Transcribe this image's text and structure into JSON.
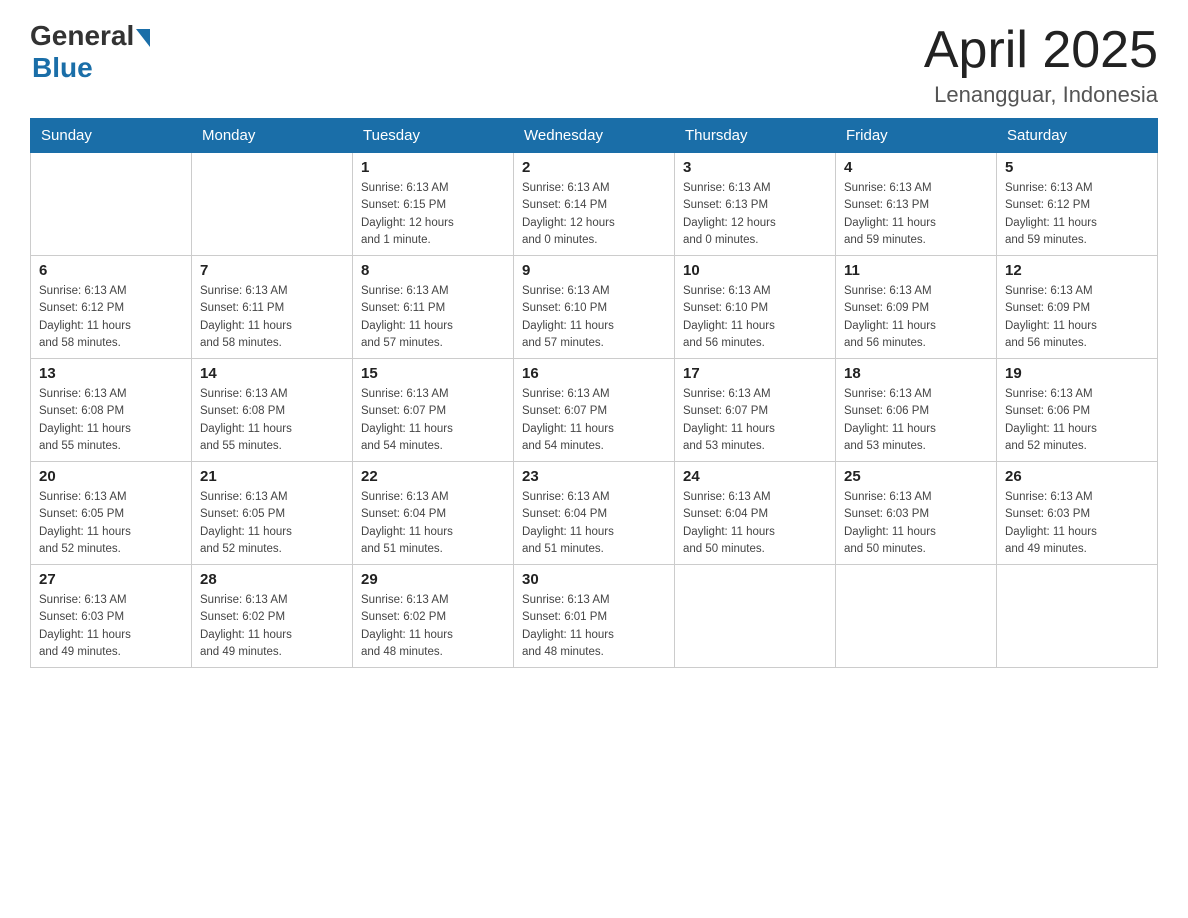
{
  "header": {
    "logo_general": "General",
    "logo_blue": "Blue",
    "month_title": "April 2025",
    "location": "Lenangguar, Indonesia"
  },
  "calendar": {
    "days_of_week": [
      "Sunday",
      "Monday",
      "Tuesday",
      "Wednesday",
      "Thursday",
      "Friday",
      "Saturday"
    ],
    "weeks": [
      [
        {
          "day": "",
          "info": ""
        },
        {
          "day": "",
          "info": ""
        },
        {
          "day": "1",
          "info": "Sunrise: 6:13 AM\nSunset: 6:15 PM\nDaylight: 12 hours\nand 1 minute."
        },
        {
          "day": "2",
          "info": "Sunrise: 6:13 AM\nSunset: 6:14 PM\nDaylight: 12 hours\nand 0 minutes."
        },
        {
          "day": "3",
          "info": "Sunrise: 6:13 AM\nSunset: 6:13 PM\nDaylight: 12 hours\nand 0 minutes."
        },
        {
          "day": "4",
          "info": "Sunrise: 6:13 AM\nSunset: 6:13 PM\nDaylight: 11 hours\nand 59 minutes."
        },
        {
          "day": "5",
          "info": "Sunrise: 6:13 AM\nSunset: 6:12 PM\nDaylight: 11 hours\nand 59 minutes."
        }
      ],
      [
        {
          "day": "6",
          "info": "Sunrise: 6:13 AM\nSunset: 6:12 PM\nDaylight: 11 hours\nand 58 minutes."
        },
        {
          "day": "7",
          "info": "Sunrise: 6:13 AM\nSunset: 6:11 PM\nDaylight: 11 hours\nand 58 minutes."
        },
        {
          "day": "8",
          "info": "Sunrise: 6:13 AM\nSunset: 6:11 PM\nDaylight: 11 hours\nand 57 minutes."
        },
        {
          "day": "9",
          "info": "Sunrise: 6:13 AM\nSunset: 6:10 PM\nDaylight: 11 hours\nand 57 minutes."
        },
        {
          "day": "10",
          "info": "Sunrise: 6:13 AM\nSunset: 6:10 PM\nDaylight: 11 hours\nand 56 minutes."
        },
        {
          "day": "11",
          "info": "Sunrise: 6:13 AM\nSunset: 6:09 PM\nDaylight: 11 hours\nand 56 minutes."
        },
        {
          "day": "12",
          "info": "Sunrise: 6:13 AM\nSunset: 6:09 PM\nDaylight: 11 hours\nand 56 minutes."
        }
      ],
      [
        {
          "day": "13",
          "info": "Sunrise: 6:13 AM\nSunset: 6:08 PM\nDaylight: 11 hours\nand 55 minutes."
        },
        {
          "day": "14",
          "info": "Sunrise: 6:13 AM\nSunset: 6:08 PM\nDaylight: 11 hours\nand 55 minutes."
        },
        {
          "day": "15",
          "info": "Sunrise: 6:13 AM\nSunset: 6:07 PM\nDaylight: 11 hours\nand 54 minutes."
        },
        {
          "day": "16",
          "info": "Sunrise: 6:13 AM\nSunset: 6:07 PM\nDaylight: 11 hours\nand 54 minutes."
        },
        {
          "day": "17",
          "info": "Sunrise: 6:13 AM\nSunset: 6:07 PM\nDaylight: 11 hours\nand 53 minutes."
        },
        {
          "day": "18",
          "info": "Sunrise: 6:13 AM\nSunset: 6:06 PM\nDaylight: 11 hours\nand 53 minutes."
        },
        {
          "day": "19",
          "info": "Sunrise: 6:13 AM\nSunset: 6:06 PM\nDaylight: 11 hours\nand 52 minutes."
        }
      ],
      [
        {
          "day": "20",
          "info": "Sunrise: 6:13 AM\nSunset: 6:05 PM\nDaylight: 11 hours\nand 52 minutes."
        },
        {
          "day": "21",
          "info": "Sunrise: 6:13 AM\nSunset: 6:05 PM\nDaylight: 11 hours\nand 52 minutes."
        },
        {
          "day": "22",
          "info": "Sunrise: 6:13 AM\nSunset: 6:04 PM\nDaylight: 11 hours\nand 51 minutes."
        },
        {
          "day": "23",
          "info": "Sunrise: 6:13 AM\nSunset: 6:04 PM\nDaylight: 11 hours\nand 51 minutes."
        },
        {
          "day": "24",
          "info": "Sunrise: 6:13 AM\nSunset: 6:04 PM\nDaylight: 11 hours\nand 50 minutes."
        },
        {
          "day": "25",
          "info": "Sunrise: 6:13 AM\nSunset: 6:03 PM\nDaylight: 11 hours\nand 50 minutes."
        },
        {
          "day": "26",
          "info": "Sunrise: 6:13 AM\nSunset: 6:03 PM\nDaylight: 11 hours\nand 49 minutes."
        }
      ],
      [
        {
          "day": "27",
          "info": "Sunrise: 6:13 AM\nSunset: 6:03 PM\nDaylight: 11 hours\nand 49 minutes."
        },
        {
          "day": "28",
          "info": "Sunrise: 6:13 AM\nSunset: 6:02 PM\nDaylight: 11 hours\nand 49 minutes."
        },
        {
          "day": "29",
          "info": "Sunrise: 6:13 AM\nSunset: 6:02 PM\nDaylight: 11 hours\nand 48 minutes."
        },
        {
          "day": "30",
          "info": "Sunrise: 6:13 AM\nSunset: 6:01 PM\nDaylight: 11 hours\nand 48 minutes."
        },
        {
          "day": "",
          "info": ""
        },
        {
          "day": "",
          "info": ""
        },
        {
          "day": "",
          "info": ""
        }
      ]
    ]
  }
}
